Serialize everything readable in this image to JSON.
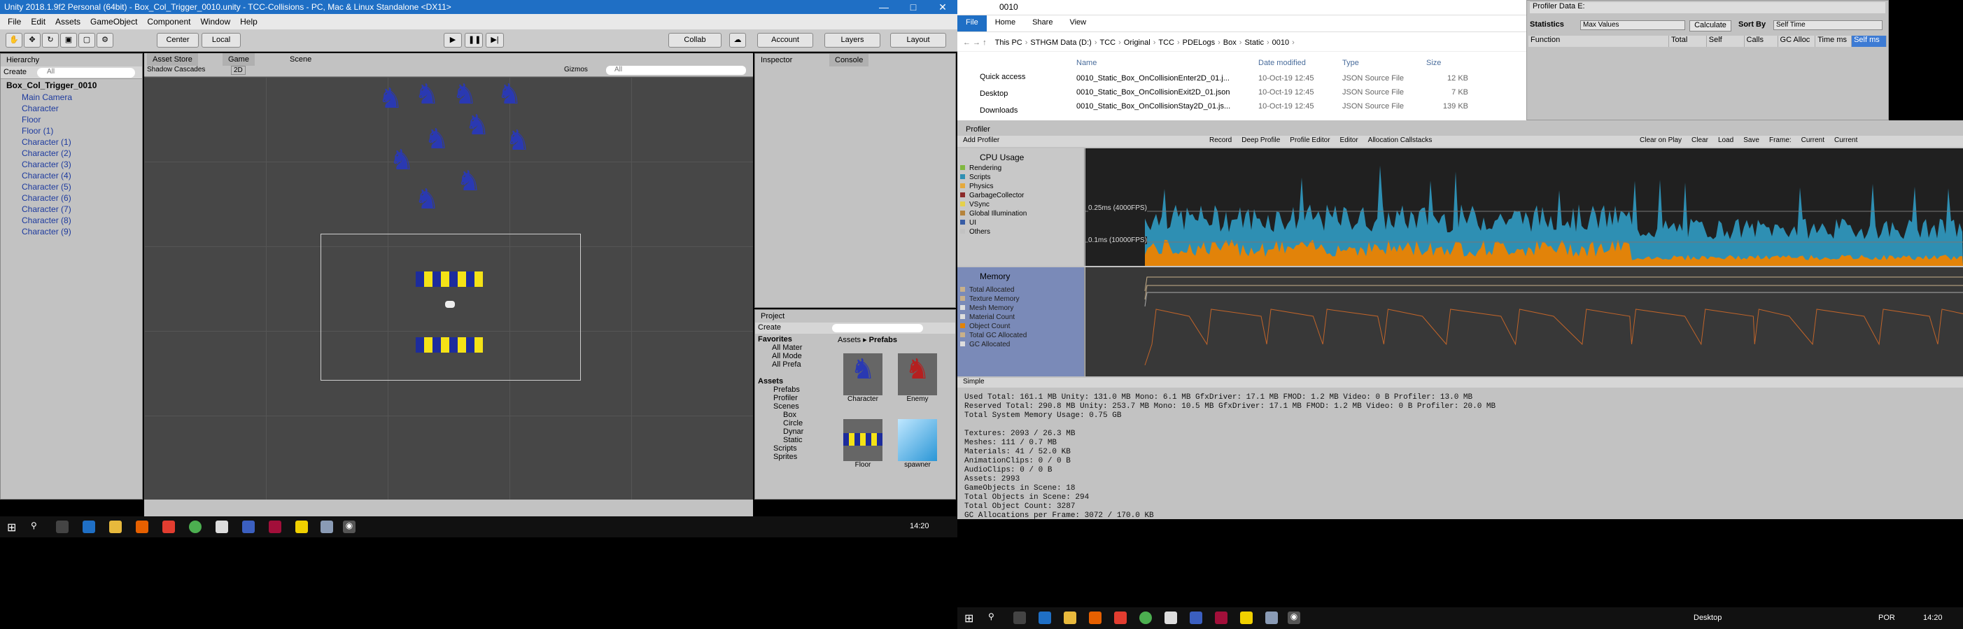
{
  "unity": {
    "title": "Unity 2018.1.9f2 Personal (64bit) - Box_Col_Trigger_0010.unity - TCC-Collisions - PC, Mac & Linux Standalone <DX11>",
    "menu": [
      "File",
      "Edit",
      "Assets",
      "GameObject",
      "Component",
      "Window",
      "Help"
    ],
    "toolbar": {
      "center": "Center",
      "local": "Local",
      "collab": "Collab",
      "account": "Account",
      "layers": "Layers",
      "layout": "Layout"
    },
    "hierarchy": {
      "tab": "Hierarchy",
      "create": "Create",
      "search": "All",
      "scene": "Box_Col_Trigger_0010",
      "items": [
        "Main Camera",
        "Character",
        "Floor",
        "Floor (1)",
        "Character (1)",
        "Character (2)",
        "Character (3)",
        "Character (4)",
        "Character (5)",
        "Character (6)",
        "Character (7)",
        "Character (8)",
        "Character (9)"
      ]
    },
    "tabs": {
      "asset_store": "Asset Store",
      "game": "Game",
      "scene": "Scene",
      "inspector": "Inspector",
      "console": "Console"
    },
    "scene_toolbar": {
      "shading": "Shadow Cascades",
      "mode": "2D",
      "gizmos": "Gizmos",
      "search": "All"
    },
    "project": {
      "tab": "Project",
      "create": "Create",
      "favorites": "Favorites",
      "fav_items": [
        "All Mater",
        "All Mode",
        "All Prefa"
      ],
      "assets": "Assets",
      "tree": [
        "Prefabs",
        "Profiler",
        "Scenes",
        "Box",
        "Circle",
        "Dynar",
        "Static",
        "Scripts",
        "Sprites"
      ],
      "breadcrumb": [
        "Assets",
        "Prefabs"
      ],
      "prefabs": [
        "Character",
        "Enemy",
        "Floor",
        "spawner"
      ]
    }
  },
  "explorer": {
    "title": "0010",
    "ribbon": [
      "File",
      "Home",
      "Share",
      "View"
    ],
    "path": [
      "This PC",
      "STHGM Data (D:)",
      "TCC",
      "Original",
      "TCC",
      "PDELogs",
      "Box",
      "Static",
      "0010"
    ],
    "nav": [
      "Quick access",
      "Desktop",
      "Downloads"
    ],
    "columns": [
      "Name",
      "Date modified",
      "Type",
      "Size"
    ],
    "files": [
      {
        "name": "0010_Static_Box_OnCollisionEnter2D_01.j...",
        "date": "10-Oct-19 12:45",
        "type": "JSON Source File",
        "size": "12 KB"
      },
      {
        "name": "0010_Static_Box_OnCollisionExit2D_01.json",
        "date": "10-Oct-19 12:45",
        "type": "JSON Source File",
        "size": "7 KB"
      },
      {
        "name": "0010_Static_Box_OnCollisionStay2D_01.js...",
        "date": "10-Oct-19 12:45",
        "type": "JSON Source File",
        "size": "139 KB"
      }
    ]
  },
  "profiler_data": {
    "title": "Profiler Data E:",
    "statistics": "Statistics",
    "max_values": "Max Values",
    "calculate": "Calculate",
    "sort_by": "Sort By",
    "self_time": "Self Time",
    "columns": [
      "Function",
      "Total",
      "Self",
      "Calls",
      "GC Alloc",
      "Time ms",
      "Self ms"
    ]
  },
  "profiler": {
    "tab": "Profiler",
    "add": "Add Profiler",
    "controls": [
      "Record",
      "Deep Profile",
      "Profile Editor",
      "Editor",
      "Allocation Callstacks"
    ],
    "right_controls": [
      "Clear on Play",
      "Clear",
      "Load",
      "Save",
      "Frame:",
      "Current",
      "Current"
    ],
    "cpu": {
      "title": "CPU Usage",
      "legend": [
        "Rendering",
        "Scripts",
        "Physics",
        "GarbageCollector",
        "VSync",
        "Global Illumination",
        "UI",
        "Others"
      ],
      "label1": "0.25ms (4000FPS)",
      "label2": "0.1ms (10000FPS)"
    },
    "memory": {
      "title": "Memory",
      "legend": [
        "Total Allocated",
        "Texture Memory",
        "Mesh Memory",
        "Material Count",
        "Object Count",
        "Total GC Allocated",
        "GC Allocated"
      ]
    },
    "mode": "Simple",
    "stats": [
      "Used Total: 161.1 MB   Unity: 131.0 MB   Mono: 6.1 MB   GfxDriver: 17.1 MB   FMOD: 1.2 MB   Video: 0 B   Profiler: 13.0 MB",
      "Reserved Total: 290.8 MB   Unity: 253.7 MB   Mono: 10.5 MB   GfxDriver: 17.1 MB   FMOD: 1.2 MB   Video: 0 B   Profiler: 20.0 MB",
      "Total System Memory Usage: 0.75 GB",
      "",
      "Textures: 2093 / 26.3 MB",
      "Meshes: 111 / 0.7 MB",
      "Materials: 41 / 52.0 KB",
      "AnimationClips: 0 / 0 B",
      "AudioClips: 0 / 0 B",
      "Assets: 2993",
      "GameObjects in Scene: 18",
      "Total Objects in Scene: 294",
      "Total Object Count: 3287",
      "GC Allocations per Frame: 3072 / 170.0 KB"
    ]
  },
  "taskbar": {
    "time_left": "14:20",
    "desktop": "Desktop",
    "lang": "POR",
    "time_right": "14:20"
  },
  "colors": {
    "cpu_blue": "#2e8fb3",
    "cpu_orange": "#e28309",
    "title_blue": "#1f6fc5"
  }
}
